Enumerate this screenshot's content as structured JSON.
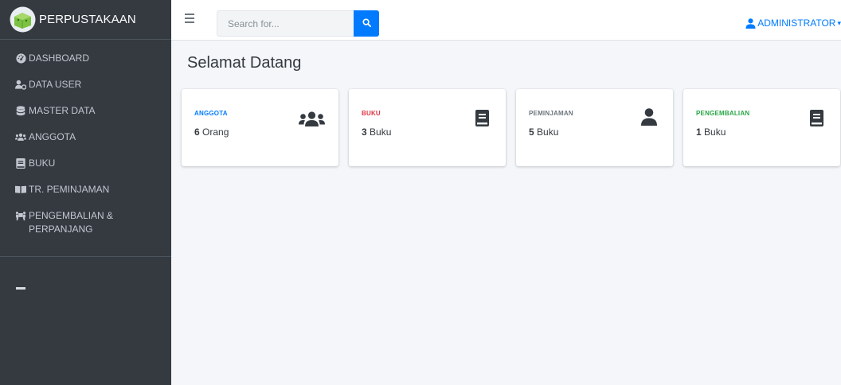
{
  "brand": {
    "name": "PERPUSTAKAAN"
  },
  "sidebar": {
    "items": [
      {
        "label": "DASHBOARD",
        "icon": "tachometer-icon"
      },
      {
        "label": "DATA USER",
        "icon": "user-cog-icon"
      },
      {
        "label": "MASTER DATA",
        "icon": "database-icon"
      },
      {
        "label": "ANGGOTA",
        "icon": "users-icon"
      },
      {
        "label": "BUKU",
        "icon": "book-icon"
      },
      {
        "label": "TR. PEMINJAMAN",
        "icon": "book-open-icon"
      },
      {
        "label": "PENGEMBALIAN &\nPERPANJANG",
        "icon": "people-carry-icon"
      }
    ]
  },
  "topbar": {
    "search_placeholder": "Search for...",
    "user_label": "ADMINISTRATOR"
  },
  "main": {
    "title": "Selamat Datang",
    "cards": [
      {
        "label": "ANGGOTA",
        "count": "6",
        "unit": "Orang",
        "color": "#007bff",
        "icon": "users-icon"
      },
      {
        "label": "BUKU",
        "count": "3",
        "unit": "Buku",
        "color": "#dc3545",
        "icon": "book-icon"
      },
      {
        "label": "PEMINJAMAN",
        "count": "5",
        "unit": "Buku",
        "color": "#6c757d",
        "icon": "user-icon"
      },
      {
        "label": "PENGEMBALIAN",
        "count": "1",
        "unit": "Buku",
        "color": "#28a745",
        "icon": "book-icon"
      }
    ]
  },
  "colors": {
    "sidebar_bg": "#343a40",
    "accent": "#007bff",
    "content_bg": "#f4f6f9"
  }
}
